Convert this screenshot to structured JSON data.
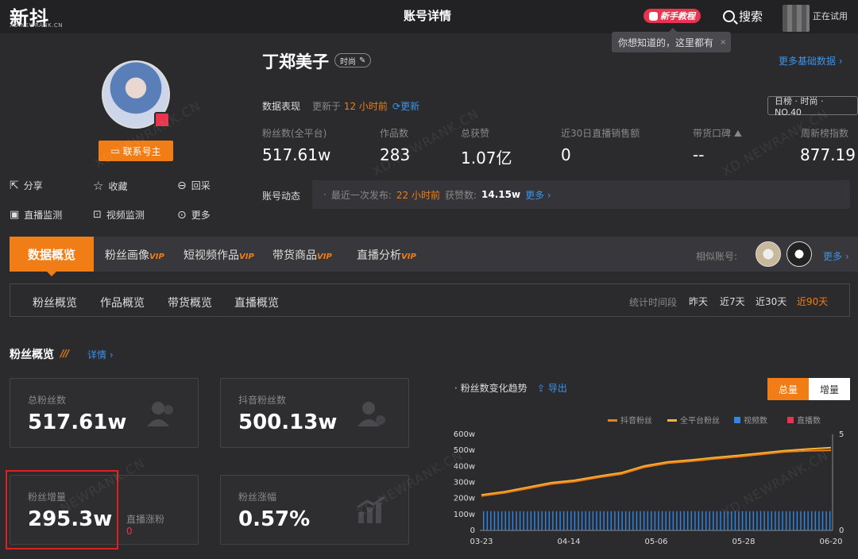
{
  "header": {
    "logo": "新抖",
    "logo_sub": "XD.NEWRANK.CN",
    "page_title": "账号详情",
    "tutorial": "新手教程",
    "tooltip": "你想知道的，这里都有",
    "tooltip_close": "×",
    "search": "搜索",
    "trial": "正在试用"
  },
  "profile": {
    "name": "丁郑美子",
    "tag": "时尚",
    "contact": "联系号主",
    "actions": [
      "分享",
      "收藏",
      "回采",
      "直播监测",
      "视频监测",
      "更多"
    ],
    "action_icons": [
      "share-icon",
      "star-icon",
      "recollect-icon",
      "live-monitor-icon",
      "video-monitor-icon",
      "more-icon"
    ],
    "more_basic": "更多基础数据 ›"
  },
  "performance": {
    "label": "数据表现",
    "updated_prefix": "更新于",
    "updated_time": "12 小时前",
    "refresh": "更新",
    "rank": "日榜 · 时尚 · NO.40",
    "stats": [
      {
        "label": "粉丝数(全平台)",
        "value": "517.61w"
      },
      {
        "label": "作品数",
        "value": "283"
      },
      {
        "label": "总获赞",
        "value": "1.07亿"
      },
      {
        "label": "近30日直播销售额",
        "value": "0"
      },
      {
        "label": "带货口碑",
        "value": "--"
      },
      {
        "label": "周新榜指数",
        "value": "877.19"
      }
    ]
  },
  "dynamics": {
    "label": "账号动态",
    "last_post_prefix": "最近一次发布:",
    "last_post": "22 小时前",
    "likes_prefix": "获赞数:",
    "likes": "14.15w",
    "more": "更多 ›"
  },
  "tabs": {
    "active": "数据概览",
    "items": [
      {
        "label": "粉丝画像",
        "vip": "VIP"
      },
      {
        "label": "短视频作品",
        "vip": "VIP"
      },
      {
        "label": "带货商品",
        "vip": "VIP"
      },
      {
        "label": "直播分析",
        "vip": "VIP"
      }
    ],
    "similar": "相似账号:",
    "more": "更多 ›"
  },
  "subtabs": {
    "items": [
      "粉丝概览",
      "作品概览",
      "带货概览",
      "直播概览"
    ],
    "period_label": "统计时间段",
    "periods": [
      "昨天",
      "近7天",
      "近30天",
      "近90天"
    ],
    "active_period": 3
  },
  "overview": {
    "title": "粉丝概览",
    "detail": "详情 ›",
    "cards": [
      {
        "label": "总粉丝数",
        "value": "517.61w"
      },
      {
        "label": "抖音粉丝数",
        "value": "500.13w"
      },
      {
        "label": "粉丝增量",
        "value": "295.3w"
      },
      {
        "label": "粉丝涨幅",
        "value": "0.57%"
      }
    ],
    "live_label": "直播涨粉",
    "live_value": "0"
  },
  "chart_controls": {
    "title": "粉丝数变化趋势",
    "export": "导出",
    "total": "总量",
    "increment": "增量"
  },
  "chart_data": {
    "type": "line",
    "legend": [
      "抖音粉丝",
      "全平台粉丝",
      "视频数",
      "直播数"
    ],
    "colors": {
      "douyin": "#f07d16",
      "all": "#f4b73a",
      "video": "#2f86e6",
      "live": "#e8344e"
    },
    "y_ticks": [
      "600w",
      "500w",
      "400w",
      "300w",
      "200w",
      "100w",
      "0"
    ],
    "y2_ticks": [
      "5",
      "0"
    ],
    "x_ticks": [
      "03-23",
      "04-14",
      "05-06",
      "05-28",
      "06-20"
    ],
    "ylim": [
      0,
      600
    ],
    "y2lim": [
      0,
      5
    ],
    "series": [
      {
        "name": "抖音粉丝",
        "values": [
          215,
          235,
          262,
          290,
          305,
          330,
          352,
          395,
          420,
          432,
          447,
          460,
          475,
          490,
          497,
          500
        ]
      },
      {
        "name": "全平台粉丝",
        "values": [
          222,
          242,
          270,
          298,
          313,
          338,
          360,
          403,
          428,
          440,
          455,
          468,
          483,
          498,
          508,
          517
        ]
      }
    ],
    "video_bars": 96,
    "video_value": 1,
    "watermark": "XD.NEWRANK.CN"
  }
}
